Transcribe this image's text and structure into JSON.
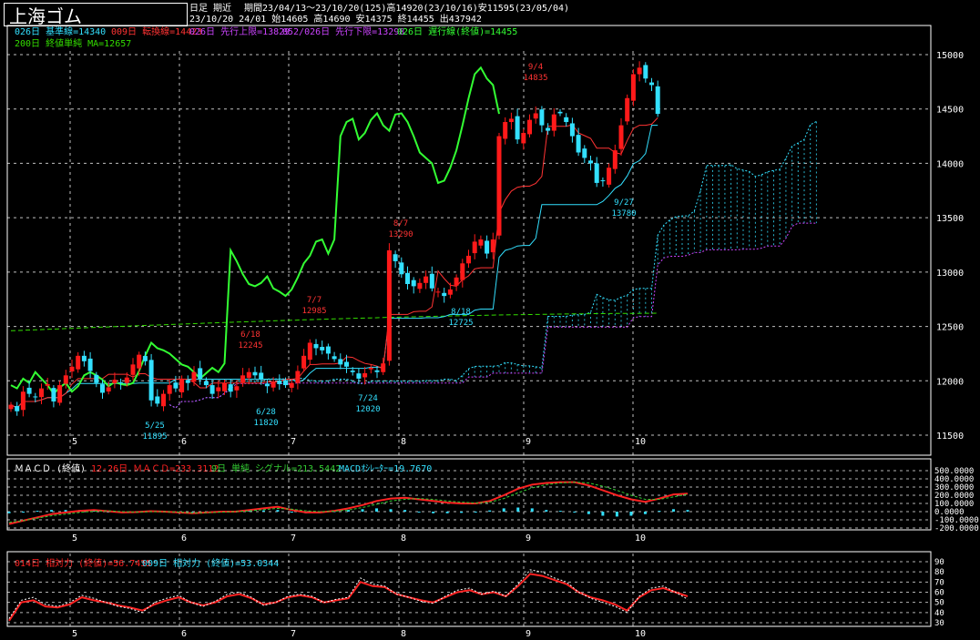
{
  "header": {
    "title": "上海ゴム",
    "sub_label": "日足 期近",
    "period_line": "期間23/04/13～23/10/20(125)高14920(23/10/16)安11595(23/05/04)",
    "date_line": "23/10/20 24/01 始14605 高14690 安14375 終14455 出437942"
  },
  "legend": {
    "kijun": "026日 基準線=14340",
    "tenkan": "009日 転換線=14423",
    "senkou_a": "026日 先行上限=13829",
    "senkou_b": "052/026日 先行下限=13298",
    "chikou": "026日 遅行線(終値)=14455",
    "ma": "200日 終値単純 MA=12657"
  },
  "macd_legend": {
    "title": "ＭＡＣＤ (終値)",
    "macd": "12-26日 ＭＡＣＤ=233.3112",
    "signal": "9日 単純 シグナル=213.5442",
    "osc": "MACDｵｼﾚｰﾀｰ=19.7670"
  },
  "rsi_legend": {
    "rsi14": "014日 相対力 (終値)=56.7435",
    "rsi9": "009日 相対力 (終値)=53.0344"
  },
  "colors": {
    "up": "#ff1a1a",
    "down": "#33e0ff",
    "ma": "#33dd00",
    "chikou": "#33ff33",
    "kijun": "#33e0ff",
    "tenkan": "#ff3333",
    "senkou_a": "#33e0ff",
    "senkou_b": "#cc44ff",
    "macd": "#ff2222",
    "signal": "#33cc33",
    "grid": "#ffffff"
  },
  "chart_data": [
    {
      "type": "candlestick",
      "title": "上海ゴム",
      "x_tick_labels": [
        "5",
        "6",
        "7",
        "8",
        "9",
        "10"
      ],
      "y_ticks": [
        11500,
        12000,
        12500,
        13000,
        13500,
        14000,
        14500,
        15000
      ],
      "ylim": [
        11500,
        15000
      ],
      "grid": true,
      "closes": [
        11780,
        11720,
        11900,
        11880,
        11850,
        11930,
        11970,
        11810,
        11960,
        12050,
        12130,
        12230,
        12180,
        12090,
        11980,
        11890,
        11940,
        12010,
        11980,
        12030,
        12150,
        12240,
        12180,
        11820,
        11790,
        11880,
        11960,
        11930,
        12020,
        11980,
        12080,
        12020,
        11960,
        11880,
        11940,
        11980,
        11900,
        11950,
        12050,
        12080,
        12050,
        12010,
        11950,
        11990,
        11970,
        11960,
        11980,
        12090,
        12230,
        12350,
        12300,
        12280,
        12250,
        12200,
        12150,
        12130,
        12080,
        12020,
        12070,
        12120,
        12080,
        12160,
        13200,
        13100,
        12980,
        12890,
        12870,
        12900,
        12960,
        12850,
        12820,
        12780,
        12840,
        12950,
        13080,
        13150,
        13280,
        13300,
        13170,
        13300,
        14250,
        14380,
        14410,
        14220,
        14280,
        14400,
        14460,
        14350,
        14300,
        14450,
        14460,
        14380,
        14250,
        14100,
        14050,
        14000,
        13820,
        13840,
        13960,
        14120,
        14350,
        14600,
        14820,
        14880,
        14780,
        14720,
        14455
      ],
      "annotations": [
        {
          "label": "5/25",
          "value": "11895"
        },
        {
          "label": "6/28",
          "value": "11820"
        },
        {
          "label": "7/24",
          "value": "12020"
        },
        {
          "label": "8/18",
          "value": "12725"
        },
        {
          "label": "9/27",
          "value": "13780"
        },
        {
          "label": "6/18",
          "value": "12245"
        },
        {
          "label": "7/7",
          "value": "12985"
        },
        {
          "label": "8/7",
          "value": "13290"
        },
        {
          "label": "9/4",
          "value": "14835"
        }
      ]
    },
    {
      "type": "line",
      "title": "ＭＡＣＤ (終値)",
      "x_tick_labels": [
        "5",
        "6",
        "7",
        "8",
        "9",
        "10"
      ],
      "y_ticks": [
        "500.0000",
        "400.0000",
        "300.0000",
        "200.0000",
        "100.0000",
        "0.0000",
        "-100.0000",
        "-200.0000"
      ],
      "ylim": [
        -200,
        500
      ],
      "series": [
        {
          "name": "12-26日 ＭＡＣＤ",
          "values": [
            -150,
            -110,
            -70,
            -30,
            -10,
            10,
            20,
            5,
            -10,
            -5,
            5,
            0,
            -10,
            -20,
            -10,
            0,
            0,
            20,
            40,
            60,
            20,
            -10,
            -10,
            10,
            40,
            80,
            130,
            160,
            170,
            150,
            130,
            110,
            100,
            100,
            130,
            200,
            280,
            330,
            350,
            360,
            360,
            320,
            260,
            200,
            150,
            120,
            160,
            210,
            220
          ]
        },
        {
          "name": "9日 単純 シグナル",
          "values": [
            -130,
            -110,
            -80,
            -50,
            -30,
            -10,
            5,
            10,
            0,
            -5,
            0,
            0,
            -5,
            -15,
            -12,
            -5,
            0,
            10,
            25,
            40,
            30,
            10,
            0,
            5,
            20,
            50,
            90,
            130,
            150,
            160,
            150,
            130,
            115,
            105,
            115,
            160,
            230,
            290,
            330,
            350,
            360,
            350,
            310,
            260,
            200,
            150,
            150,
            180,
            213
          ]
        }
      ],
      "oscillator": [
        -20,
        0,
        10,
        20,
        20,
        20,
        15,
        -5,
        -10,
        0,
        5,
        0,
        -5,
        -5,
        2,
        5,
        0,
        10,
        15,
        20,
        -10,
        -20,
        -10,
        5,
        20,
        30,
        40,
        30,
        20,
        -10,
        -20,
        -20,
        -15,
        -5,
        15,
        40,
        50,
        40,
        20,
        10,
        0,
        -30,
        -50,
        -60,
        -50,
        -30,
        10,
        30,
        20
      ]
    },
    {
      "type": "line",
      "title": "相対力",
      "x_tick_labels": [
        "5",
        "6",
        "7",
        "8",
        "9",
        "10"
      ],
      "y_ticks": [
        30,
        40,
        50,
        60,
        70,
        80,
        90
      ],
      "ylim": [
        30,
        90
      ],
      "series": [
        {
          "name": "014日 相対力 (終値)",
          "values": [
            32,
            50,
            52,
            46,
            45,
            48,
            55,
            52,
            50,
            47,
            45,
            42,
            48,
            52,
            55,
            50,
            47,
            50,
            56,
            58,
            54,
            48,
            50,
            55,
            57,
            55,
            50,
            52,
            54,
            70,
            66,
            65,
            58,
            55,
            52,
            50,
            55,
            60,
            62,
            58,
            60,
            56,
            66,
            78,
            76,
            72,
            68,
            60,
            55,
            52,
            48,
            42,
            55,
            62,
            64,
            60,
            56
          ]
        },
        {
          "name": "009日 相対力 (終値)",
          "values": [
            34,
            52,
            55,
            48,
            46,
            50,
            57,
            54,
            50,
            46,
            44,
            40,
            50,
            54,
            57,
            50,
            46,
            51,
            58,
            60,
            55,
            47,
            50,
            56,
            58,
            56,
            50,
            53,
            55,
            74,
            68,
            66,
            58,
            55,
            51,
            49,
            56,
            62,
            64,
            58,
            61,
            56,
            68,
            82,
            80,
            74,
            70,
            60,
            54,
            50,
            46,
            40,
            56,
            64,
            66,
            60,
            53
          ]
        }
      ]
    }
  ]
}
